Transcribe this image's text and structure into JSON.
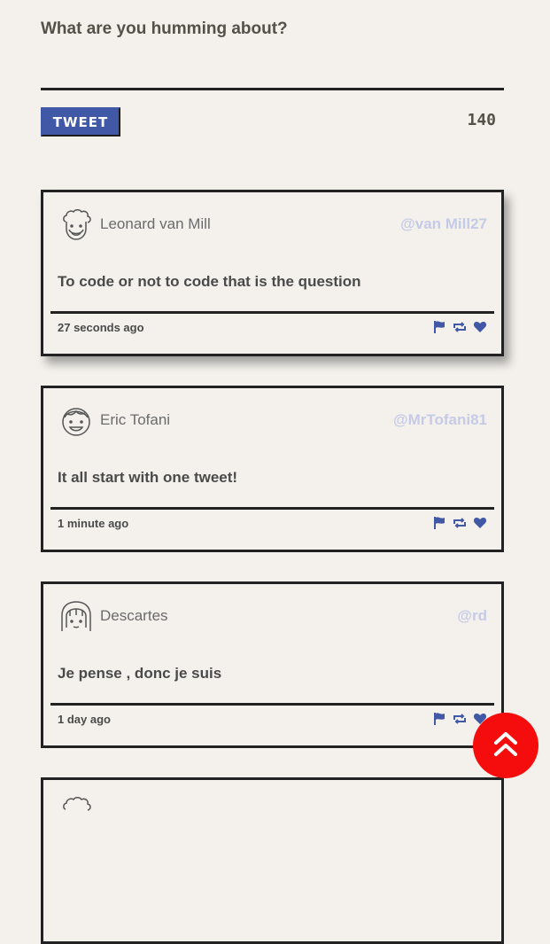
{
  "compose": {
    "placeholder": "What are you humming about?",
    "button_label": "TWEET",
    "counter": "140"
  },
  "tweets": [
    {
      "name": "Leonard van Mill",
      "handle": "@van Mill27",
      "content": "To code or not to code that is the question",
      "time": "27 seconds ago",
      "avatar": "curly-hair-avatar-icon"
    },
    {
      "name": "Eric Tofani",
      "handle": "@MrTofani81",
      "content": "It all start with one tweet!",
      "time": "1 minute ago",
      "avatar": "boy-avatar-icon"
    },
    {
      "name": "Descartes",
      "handle": "@rd",
      "content": "Je pense , donc je suis",
      "time": "1 day ago",
      "avatar": "girl-avatar-icon"
    }
  ],
  "icons": {
    "flag": "flag-icon",
    "retweet": "retweet-icon",
    "like": "heart-icon",
    "scroll_top": "double-chevron-up-icon"
  },
  "colors": {
    "accent": "#4158a6",
    "handle": "#c5cbe6",
    "scroll_button": "#f50d0d",
    "background": "#f4f1ec"
  }
}
